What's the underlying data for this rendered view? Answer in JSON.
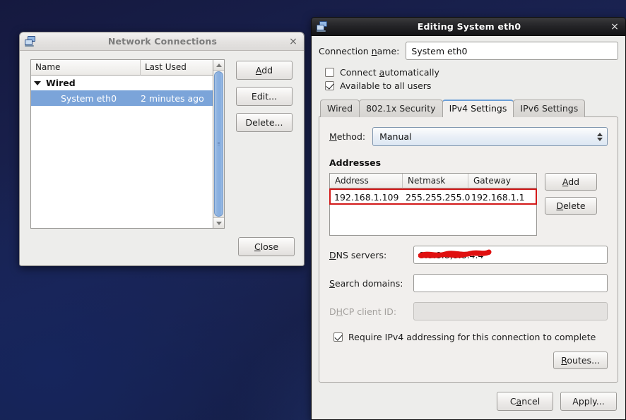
{
  "desktop": {
    "background_color": "#16204c"
  },
  "network_connections_window": {
    "title": "Network Connections",
    "icon": "network-computers-icon",
    "close_label": "×",
    "list": {
      "columns": [
        "Name",
        "Last Used"
      ],
      "groups": [
        {
          "label": "Wired",
          "expanded": true,
          "rows": [
            {
              "name": "System eth0",
              "last_used": "2 minutes ago",
              "selected": true
            }
          ]
        }
      ]
    },
    "buttons": {
      "add": "Add",
      "edit": "Edit...",
      "delete": "Delete...",
      "close": "Close"
    },
    "selection_color": "#7ba4d9"
  },
  "edit_dialog": {
    "title": "Editing System eth0",
    "icon": "network-computers-icon",
    "close_label": "×",
    "connection_name": {
      "label": "Connection name:",
      "value": "System eth0",
      "placeholder": ""
    },
    "checkboxes": {
      "connect_automatically": {
        "label": "Connect automatically",
        "checked": false
      },
      "available_to_all_users": {
        "label": "Available to all users",
        "checked": true
      }
    },
    "tabs": [
      {
        "label": "Wired",
        "active": false
      },
      {
        "label": "802.1x Security",
        "active": false
      },
      {
        "label": "IPv4 Settings",
        "active": true
      },
      {
        "label": "IPv6 Settings",
        "active": false
      }
    ],
    "ipv4": {
      "method": {
        "label": "Method:",
        "value": "Manual"
      },
      "addresses_title": "Addresses",
      "addresses_columns": [
        "Address",
        "Netmask",
        "Gateway"
      ],
      "addresses_rows": [
        {
          "address": "192.168.1.109",
          "netmask": "255.255.255.0",
          "gateway": "192.168.1.1",
          "highlighted": true
        }
      ],
      "addresses_buttons": {
        "add": "Add",
        "delete": "Delete"
      },
      "dns_servers": {
        "label": "DNS servers:",
        "value": "8.8.8.8,8.8.4.4",
        "redacted": true
      },
      "search_domains": {
        "label": "Search domains:",
        "value": "",
        "placeholder": ""
      },
      "dhcp_client_id": {
        "label": "DHCP client ID:",
        "value": "",
        "placeholder": "",
        "disabled": true
      },
      "require_ipv4": {
        "label": "Require IPv4 addressing for this connection to complete",
        "checked": true
      },
      "routes_button": "Routes..."
    },
    "footer_buttons": {
      "cancel": "Cancel",
      "apply": "Apply..."
    },
    "highlight_color": "#d31919",
    "redaction_color": "#e01010"
  }
}
